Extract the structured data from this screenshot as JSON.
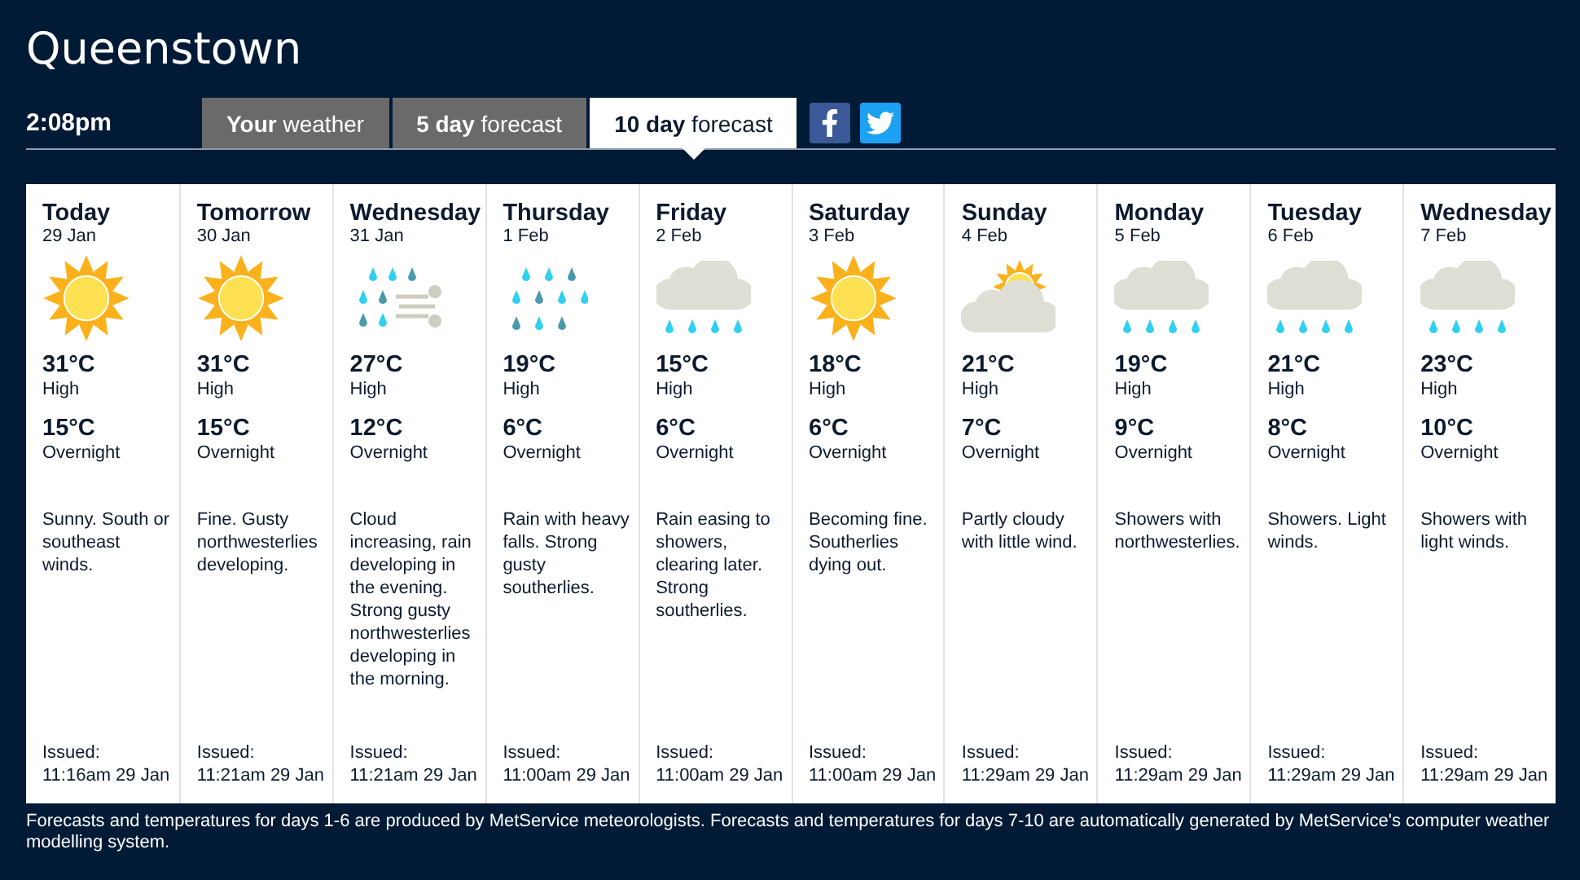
{
  "title": "Queenstown",
  "time": "2:08pm",
  "tabs": [
    {
      "label": "**Your** weather",
      "selected": false
    },
    {
      "label": "**5 day** forecast",
      "selected": false
    },
    {
      "label": "**10 day** forecast",
      "selected": true
    }
  ],
  "share": [
    {
      "kind": "facebook"
    },
    {
      "kind": "twitter"
    }
  ],
  "days": [
    {
      "day": "Today",
      "date": "29 Jan",
      "kind": "sunny",
      "high": "31°C",
      "high_label": "High",
      "low": "15°C",
      "low_label": "Overnight",
      "summary": "Sunny. South or southeast winds.",
      "issued_label": "Issued:",
      "issued": "11:16am 29 Jan"
    },
    {
      "day": "Tomorrow",
      "date": "30 Jan",
      "kind": "sunny",
      "high": "31°C",
      "high_label": "High",
      "low": "15°C",
      "low_label": "Overnight",
      "summary": "Fine. Gusty northwesterlies developing.",
      "issued_label": "Issued:",
      "issued": "11:21am 29 Jan"
    },
    {
      "day": "Wednesday",
      "date": "31 Jan",
      "kind": "wind-rain",
      "high": "27°C",
      "high_label": "High",
      "low": "12°C",
      "low_label": "Overnight",
      "summary": "Cloud increasing, rain developing in the evening. Strong gusty northwesterlies developing in the morning.",
      "issued_label": "Issued:",
      "issued": "11:21am 29 Jan"
    },
    {
      "day": "Thursday",
      "date": "1 Feb",
      "kind": "heavy-rain",
      "high": "19°C",
      "high_label": "High",
      "low": "6°C",
      "low_label": "Overnight",
      "summary": "Rain with heavy falls. Strong gusty southerlies.",
      "issued_label": "Issued:",
      "issued": "11:00am 29 Jan"
    },
    {
      "day": "Friday",
      "date": "2 Feb",
      "kind": "showers",
      "high": "15°C",
      "high_label": "High",
      "low": "6°C",
      "low_label": "Overnight",
      "summary": "Rain easing to showers, clearing later. Strong southerlies.",
      "issued_label": "Issued:",
      "issued": "11:00am 29 Jan"
    },
    {
      "day": "Saturday",
      "date": "3 Feb",
      "kind": "sunny",
      "high": "18°C",
      "high_label": "High",
      "low": "6°C",
      "low_label": "Overnight",
      "summary": "Becoming fine. Southerlies dying out.",
      "issued_label": "Issued:",
      "issued": "11:00am 29 Jan"
    },
    {
      "day": "Sunday",
      "date": "4 Feb",
      "kind": "partly-cloudy",
      "high": "21°C",
      "high_label": "High",
      "low": "7°C",
      "low_label": "Overnight",
      "summary": "Partly cloudy with little wind.",
      "issued_label": "Issued:",
      "issued": "11:29am 29 Jan"
    },
    {
      "day": "Monday",
      "date": "5 Feb",
      "kind": "showers",
      "high": "19°C",
      "high_label": "High",
      "low": "9°C",
      "low_label": "Overnight",
      "summary": "Showers with northwesterlies.",
      "issued_label": "Issued:",
      "issued": "11:29am 29 Jan"
    },
    {
      "day": "Tuesday",
      "date": "6 Feb",
      "kind": "showers",
      "high": "21°C",
      "high_label": "High",
      "low": "8°C",
      "low_label": "Overnight",
      "summary": "Showers. Light winds.",
      "issued_label": "Issued:",
      "issued": "11:29am 29 Jan"
    },
    {
      "day": "Wednesday",
      "date": "7 Feb",
      "kind": "showers",
      "high": "23°C",
      "high_label": "High",
      "low": "10°C",
      "low_label": "Overnight",
      "summary": "Showers with light winds.",
      "issued_label": "Issued:",
      "issued": "11:29am 29 Jan"
    }
  ],
  "footnote": "Forecasts and temperatures for days 1-6 are produced by MetService meteorologists. Forecasts and temperatures for days 7-10 are automatically generated by MetService's computer weather modelling system."
}
